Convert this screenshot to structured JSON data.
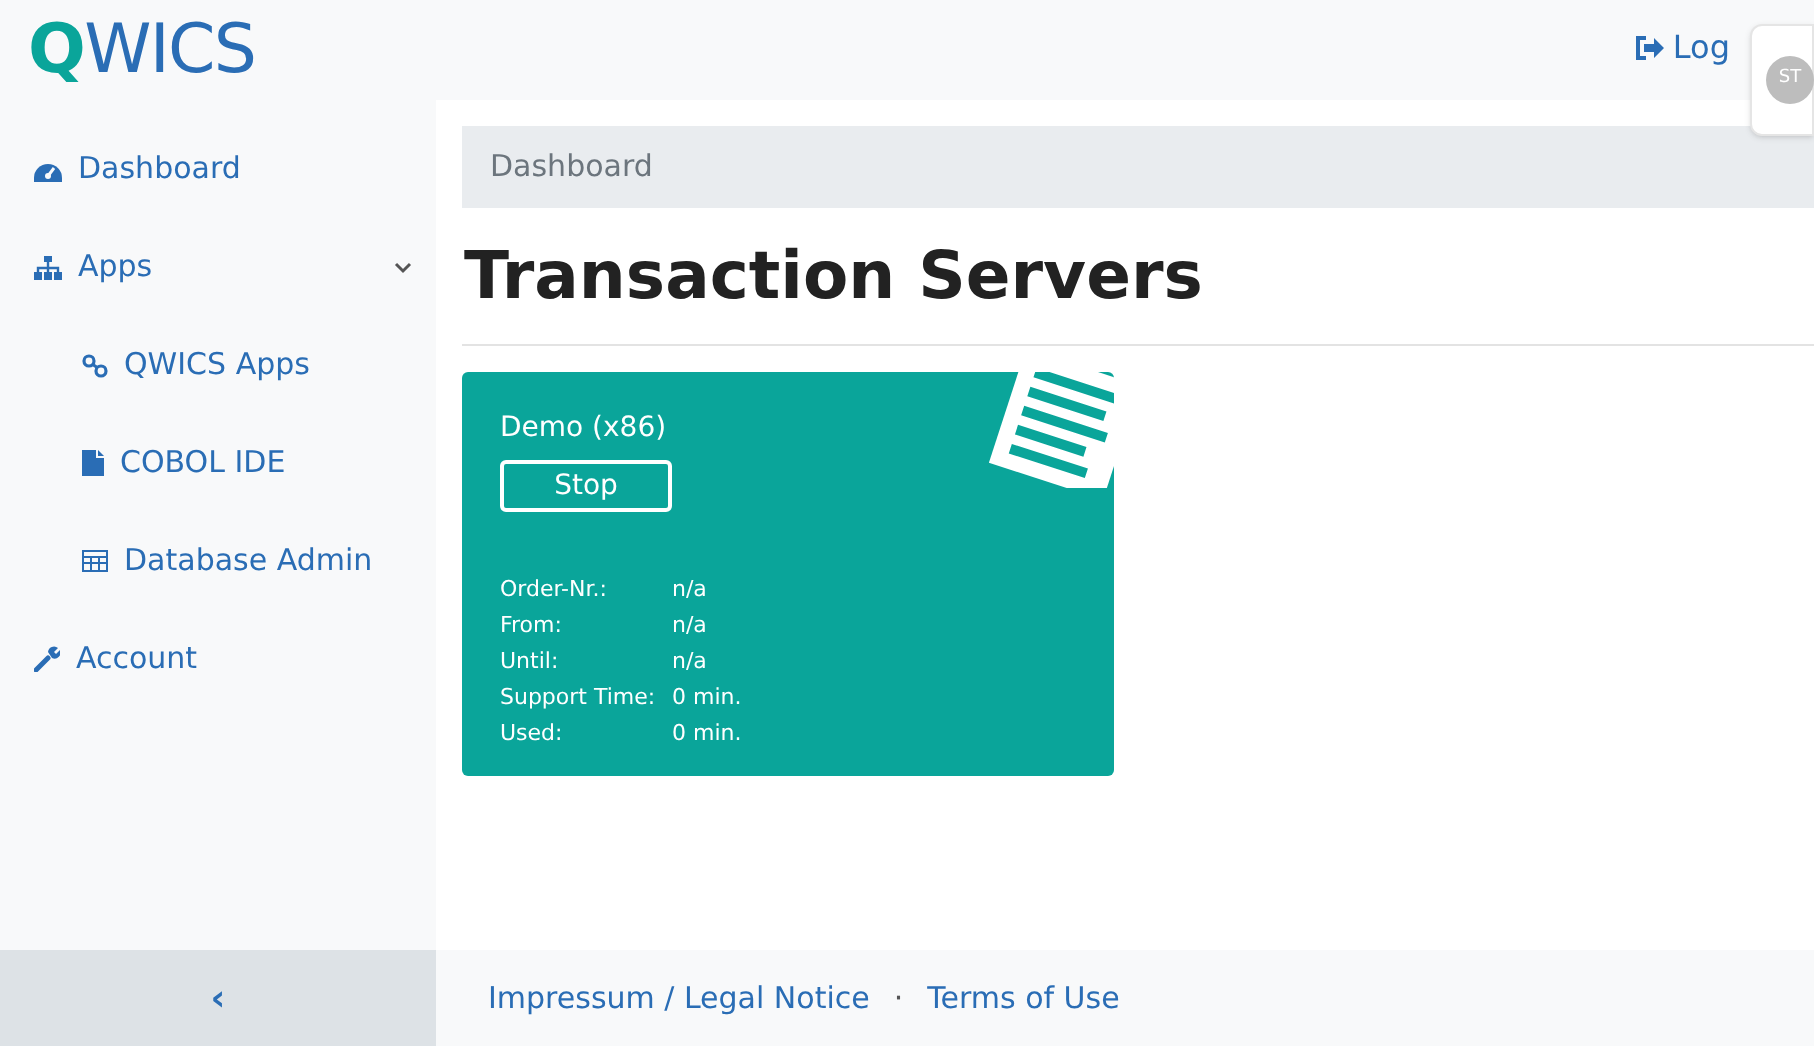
{
  "header": {
    "logo": "QWICS",
    "logout_link": "Log",
    "avatar": "ST"
  },
  "sidebar": {
    "items": [
      {
        "label": "Dashboard"
      },
      {
        "label": "Apps",
        "expanded": true,
        "children": [
          {
            "label": "QWICS Apps"
          },
          {
            "label": "COBOL IDE"
          },
          {
            "label": "Database Admin"
          }
        ]
      },
      {
        "label": "Account"
      }
    ],
    "toggle": "‹"
  },
  "breadcrumb": "Dashboard",
  "title": "Transaction Servers",
  "servers": [
    {
      "name": "Demo (x86)",
      "button": "Stop",
      "fields": [
        {
          "label": "Order-Nr.:",
          "value": "n/a"
        },
        {
          "label": "From:",
          "value": "n/a"
        },
        {
          "label": "Until:",
          "value": "n/a"
        },
        {
          "label": "Support Time:",
          "value": "0 min."
        },
        {
          "label": "Used:",
          "value": "0 min."
        }
      ]
    }
  ],
  "footer": {
    "links": [
      "Impressum / Legal Notice",
      "Terms of Use"
    ],
    "separator": "·"
  }
}
